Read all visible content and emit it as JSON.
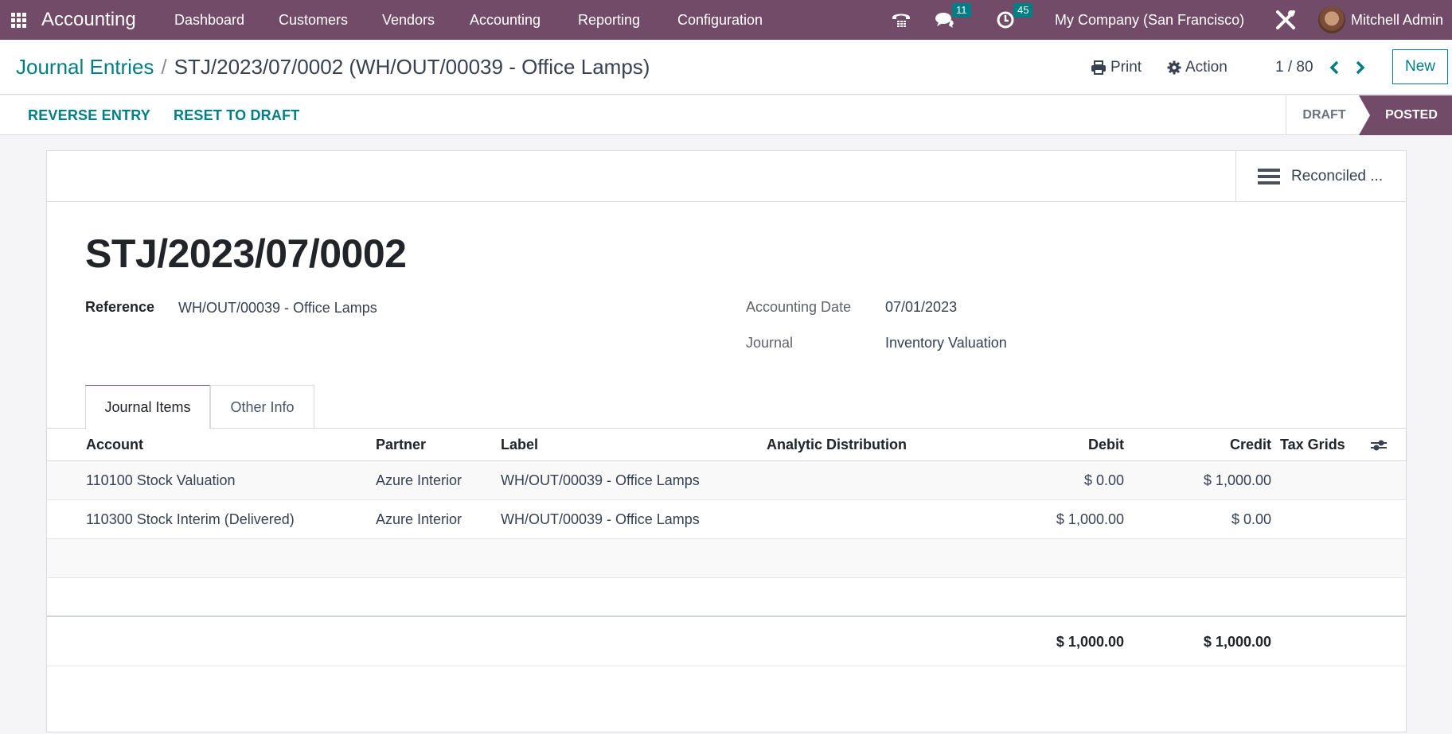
{
  "navbar": {
    "app_name": "Accounting",
    "menu": [
      "Dashboard",
      "Customers",
      "Vendors",
      "Accounting",
      "Reporting",
      "Configuration"
    ],
    "messages_count": "11",
    "activities_count": "45",
    "company": "My Company (San Francisco)",
    "user_name": "Mitchell Admin",
    "icons": {
      "apps": "apps-grid-icon",
      "phone": "phone-icon",
      "chat": "chat-icon",
      "clock": "clock-icon",
      "tools": "debug-tools-icon"
    }
  },
  "control_panel": {
    "breadcrumb_parent": "Journal Entries",
    "breadcrumb_separator": "/",
    "breadcrumb_current": "STJ/2023/07/0002 (WH/OUT/00039 - Office Lamps)",
    "print_label": "Print",
    "action_label": "Action",
    "pager": "1 / 80",
    "new_label": "New"
  },
  "status_bar": {
    "buttons": [
      "REVERSE ENTRY",
      "RESET TO DRAFT"
    ],
    "stages": [
      "DRAFT",
      "POSTED"
    ],
    "current_stage": "POSTED"
  },
  "sheet": {
    "smart_button_label": "Reconciled ...",
    "title": "STJ/2023/07/0002",
    "fields": {
      "reference_label": "Reference",
      "reference_value": "WH/OUT/00039 - Office Lamps",
      "accounting_date_label": "Accounting Date",
      "accounting_date_value": "07/01/2023",
      "journal_label": "Journal",
      "journal_value": "Inventory Valuation"
    },
    "tabs": [
      "Journal Items",
      "Other Info"
    ],
    "active_tab": "Journal Items",
    "table": {
      "columns": [
        "Account",
        "Partner",
        "Label",
        "Analytic Distribution",
        "Debit",
        "Credit",
        "Tax Grids"
      ],
      "rows": [
        {
          "account": "110100 Stock Valuation",
          "partner": "Azure Interior",
          "label": "WH/OUT/00039 - Office Lamps",
          "analytic": "",
          "debit": "$ 0.00",
          "credit": "$ 1,000.00",
          "tax_grids": ""
        },
        {
          "account": "110300 Stock Interim (Delivered)",
          "partner": "Azure Interior",
          "label": "WH/OUT/00039 - Office Lamps",
          "analytic": "",
          "debit": "$ 1,000.00",
          "credit": "$ 0.00",
          "tax_grids": ""
        }
      ],
      "totals": {
        "debit": "$ 1,000.00",
        "credit": "$ 1,000.00"
      }
    }
  },
  "colors": {
    "brand": "#714b67",
    "accent": "#017e84"
  }
}
